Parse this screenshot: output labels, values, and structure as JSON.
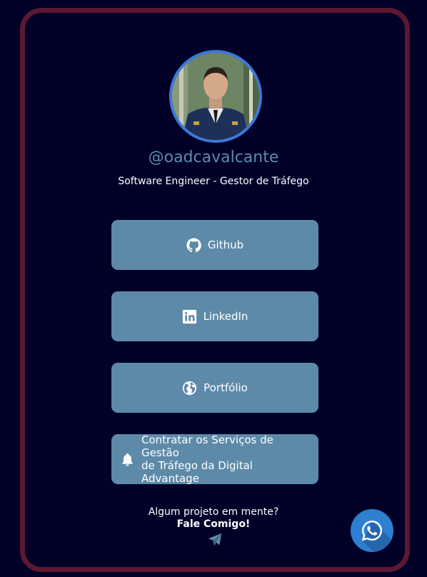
{
  "profile": {
    "handle": "@oadcavalcante",
    "subtitle": "Software Engineer - Gestor de Tráfego"
  },
  "links": [
    {
      "label": "Github",
      "icon": "github-icon"
    },
    {
      "label": "LinkedIn",
      "icon": "linkedin-icon"
    },
    {
      "label": "Portfólio",
      "icon": "globe-icon"
    },
    {
      "label_line1": "Contratar os Serviços de Gestão",
      "label_line2": "de Tráfego da Digital Advantage",
      "icon": "bell-icon"
    }
  ],
  "cta": {
    "question": "Algum projeto em mente?",
    "action": "Fale Comigo!"
  },
  "colors": {
    "background": "#000029",
    "card_border": "#5b1830",
    "button": "#5d8aa8",
    "handle": "#5f8bab",
    "avatar_ring": "#3b78d8",
    "whatsapp": "#2e7fd0"
  }
}
